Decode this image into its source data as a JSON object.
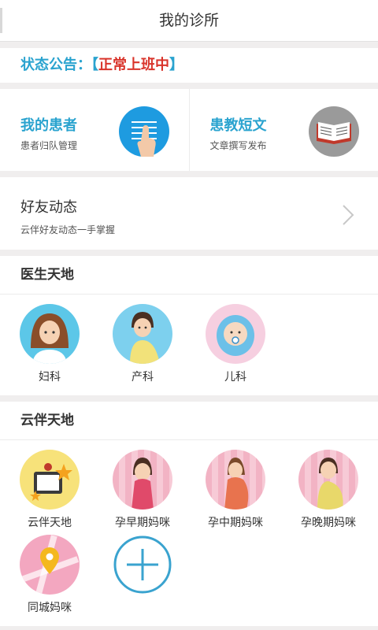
{
  "header": {
    "title": "我的诊所"
  },
  "notice": {
    "label": "状态公告：",
    "open_bracket": "【",
    "status": "正常上班中",
    "close_bracket": "】"
  },
  "cards": [
    {
      "title": "我的患者",
      "subtitle": "患者归队管理",
      "icon": "patients-list-icon"
    },
    {
      "title": "患教短文",
      "subtitle": "文章撰写发布",
      "icon": "book-icon"
    }
  ],
  "friends": {
    "title": "好友动态",
    "subtitle": "云伴好友动态一手掌握",
    "icon": "chevron-right-icon"
  },
  "doctor_section": {
    "title": "医生天地",
    "items": [
      {
        "label": "妇科",
        "icon": "gynecology-avatar-icon"
      },
      {
        "label": "产科",
        "icon": "obstetrics-avatar-icon"
      },
      {
        "label": "儿科",
        "icon": "pediatrics-avatar-icon"
      }
    ]
  },
  "yunban_section": {
    "title": "云伴天地",
    "items": [
      {
        "label": "云伴天地",
        "icon": "yunban-tv-icon"
      },
      {
        "label": "孕早期妈咪",
        "icon": "early-pregnancy-icon"
      },
      {
        "label": "孕中期妈咪",
        "icon": "mid-pregnancy-icon"
      },
      {
        "label": "孕晚期妈咪",
        "icon": "late-pregnancy-icon"
      },
      {
        "label": "同城妈咪",
        "icon": "map-pin-icon"
      }
    ],
    "add_icon": "add-icon"
  },
  "colors": {
    "accent": "#2aa3cf",
    "status": "#d9342b"
  }
}
